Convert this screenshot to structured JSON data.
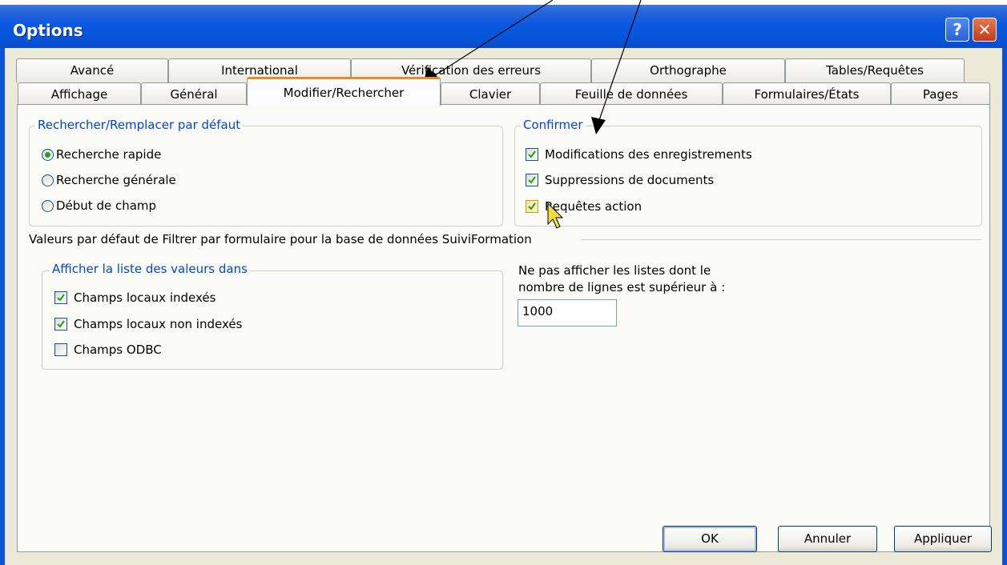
{
  "window": {
    "title": "Options"
  },
  "titlebar": {
    "help_label": "?",
    "close_label": "✕"
  },
  "tabs": {
    "row_back": [
      "Avancé",
      "International",
      "Vérification des erreurs",
      "Orthographe",
      "Tables/Requêtes"
    ],
    "row_front": [
      "Affichage",
      "Général",
      "Modifier/Rechercher",
      "Clavier",
      "Feuille de données",
      "Formulaires/États",
      "Pages"
    ],
    "active": "Modifier/Rechercher"
  },
  "search_group": {
    "legend": "Rechercher/Remplacer par défaut",
    "options": [
      "Recherche rapide",
      "Recherche générale",
      "Début de champ"
    ],
    "selected": "Recherche rapide"
  },
  "confirm_group": {
    "legend": "Confirmer",
    "items": [
      {
        "label": "Modifications des enregistrements",
        "checked": true
      },
      {
        "label": "Suppressions de documents",
        "checked": true
      },
      {
        "label": "Requêtes action",
        "checked": true
      }
    ]
  },
  "filter_section": {
    "heading": "Valeurs par défaut de Filtrer par formulaire pour la base de données SuiviFormation",
    "list_group": {
      "legend": "Afficher la liste des valeurs dans",
      "items": [
        {
          "label": "Champs locaux indexés",
          "checked": true
        },
        {
          "label": "Champs locaux non indexés",
          "checked": true
        },
        {
          "label": "Champs ODBC",
          "checked": false
        }
      ]
    },
    "limit_label_line1": "Ne pas afficher les listes dont le",
    "limit_label_line2": "nombre de lignes est supérieur à :",
    "limit_value": "1000"
  },
  "buttons": {
    "ok": "OK",
    "cancel": "Annuler",
    "apply": "Appliquer"
  },
  "colors": {
    "title_bar": "#0a58e0",
    "active_tab_accent": "#e68b2c",
    "group_legend": "#0046d5",
    "checkmark": "#21a121"
  }
}
